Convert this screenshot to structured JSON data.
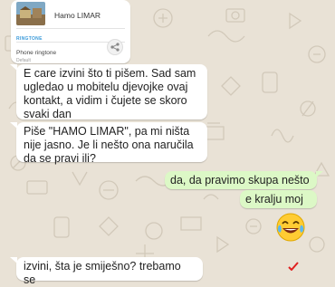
{
  "colors": {
    "background": "#e9e2d6",
    "incoming": "#ffffff",
    "outgoing": "#dcf8c6",
    "accent": "#3a9ad9"
  },
  "ringtone_card": {
    "title": "Hamo LIMAR",
    "tag": "RINGTONE",
    "subtitle": "Phone ringtone",
    "detail": "Default",
    "icons": [
      "song-thumbnail",
      "share-icon"
    ]
  },
  "messages": [
    {
      "side": "incoming",
      "text": "E care izvini što ti pišem. Sad sam\nugledao u mobitelu djevojke ovaj\nkontakt, a vidim i čujete se skoro\nsvaki dan"
    },
    {
      "side": "incoming",
      "text": "Piše \"HAMO LIMAR\", pa mi ništa\nnije jasno. Je li nešto ona naručila\nda se pravi ili?"
    },
    {
      "side": "outgoing",
      "text": "da, da pravimo skupa nešto"
    },
    {
      "side": "outgoing",
      "text": "e kralju moj"
    },
    {
      "side": "outgoing",
      "emoji": "face-with-tears-of-joy"
    },
    {
      "side": "incoming",
      "text": "izvini, šta je smiješno? trebamo se"
    }
  ]
}
